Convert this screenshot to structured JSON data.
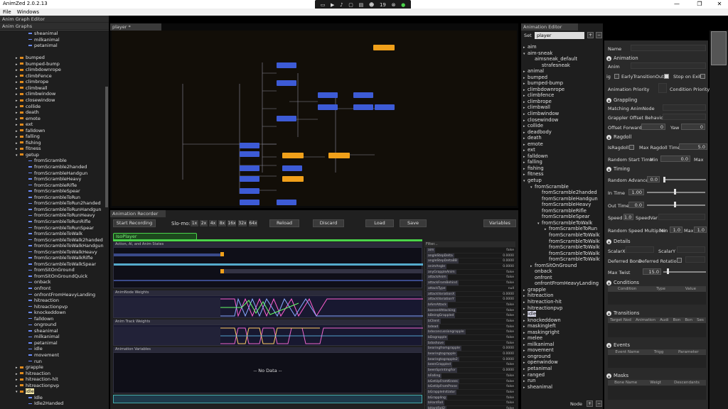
{
  "window": {
    "title": "AnimZed 2.0.2.13",
    "min": "—",
    "max": "❐",
    "close": "✕"
  },
  "tray": {
    "count": "19"
  },
  "menu": [
    "File",
    "Windows"
  ],
  "graph_tabs": [
    "Anim Graph Editor",
    "Anim Graphs"
  ],
  "tree": [
    {
      "label": "sheanimal",
      "type": "leaf",
      "indent": 3
    },
    {
      "label": "milkanimal",
      "type": "leaf",
      "indent": 3
    },
    {
      "label": "petanimal",
      "type": "leaf",
      "indent": 3
    },
    {
      "label": "",
      "type": "blank",
      "indent": 2
    },
    {
      "label": "bumped",
      "type": "folder",
      "indent": 2
    },
    {
      "label": "bumped-bump",
      "type": "folder",
      "indent": 2
    },
    {
      "label": "climbdownrope",
      "type": "folder",
      "indent": 2
    },
    {
      "label": "climbFence",
      "type": "folder",
      "indent": 2
    },
    {
      "label": "climbrope",
      "type": "folder",
      "indent": 2
    },
    {
      "label": "climbwall",
      "type": "folder",
      "indent": 2
    },
    {
      "label": "climbwindow",
      "type": "folder",
      "indent": 2
    },
    {
      "label": "closewindow",
      "type": "folder",
      "indent": 2
    },
    {
      "label": "collide",
      "type": "folder",
      "indent": 2
    },
    {
      "label": "death",
      "type": "folder",
      "indent": 2
    },
    {
      "label": "emote",
      "type": "folder",
      "indent": 2
    },
    {
      "label": "ext",
      "type": "folder",
      "indent": 2
    },
    {
      "label": "falldown",
      "type": "folder",
      "indent": 2
    },
    {
      "label": "falling",
      "type": "folder",
      "indent": 2
    },
    {
      "label": "fishing",
      "type": "folder",
      "indent": 2
    },
    {
      "label": "fitness",
      "type": "folder",
      "indent": 2
    },
    {
      "label": "getup",
      "type": "folder-open",
      "indent": 2
    },
    {
      "label": "fromScramble",
      "type": "leaf",
      "indent": 3
    },
    {
      "label": "fromScramble2handed",
      "type": "leaf",
      "indent": 3
    },
    {
      "label": "fromScrambleHandgun",
      "type": "leaf",
      "indent": 3
    },
    {
      "label": "fromScrambleHeavy",
      "type": "leaf",
      "indent": 3
    },
    {
      "label": "fromScrambleRifle",
      "type": "leaf",
      "indent": 3
    },
    {
      "label": "fromScrambleSpear",
      "type": "leaf",
      "indent": 3
    },
    {
      "label": "fromScrambleToRun",
      "type": "leaf",
      "indent": 3
    },
    {
      "label": "fromScrambleToRun2handed",
      "type": "leaf",
      "indent": 3
    },
    {
      "label": "fromScrambleToRunHandgun",
      "type": "leaf",
      "indent": 3
    },
    {
      "label": "fromScrambleToRunHeavy",
      "type": "leaf",
      "indent": 3
    },
    {
      "label": "fromScrambleToRunRifle",
      "type": "leaf",
      "indent": 3
    },
    {
      "label": "fromScrambleToRunSpear",
      "type": "leaf",
      "indent": 3
    },
    {
      "label": "fromScrambleToWalk",
      "type": "leaf",
      "indent": 3
    },
    {
      "label": "fromScrambleToWalk2handed",
      "type": "leaf",
      "indent": 3
    },
    {
      "label": "fromScrambleToWalkHandgun",
      "type": "leaf",
      "indent": 3
    },
    {
      "label": "fromScrambleToWalkHeavy",
      "type": "leaf",
      "indent": 3
    },
    {
      "label": "fromScrambleToWalkRifle",
      "type": "leaf",
      "indent": 3
    },
    {
      "label": "fromScrambleToWalkSpear",
      "type": "leaf",
      "indent": 3
    },
    {
      "label": "fromSitOnGround",
      "type": "leaf",
      "indent": 3
    },
    {
      "label": "fromSitOnGroundQuick",
      "type": "leaf",
      "indent": 3
    },
    {
      "label": "onback",
      "type": "leaf",
      "indent": 3
    },
    {
      "label": "onfront",
      "type": "leaf",
      "indent": 3
    },
    {
      "label": "onfrontFromHeavyLanding",
      "type": "leaf",
      "indent": 3
    },
    {
      "label": "hitreaction",
      "type": "leaf",
      "indent": 3
    },
    {
      "label": "hitreactionpvp",
      "type": "leaf",
      "indent": 3
    },
    {
      "label": "knockeddown",
      "type": "leaf",
      "indent": 3
    },
    {
      "label": "falldown",
      "type": "leaf",
      "indent": 3
    },
    {
      "label": "onground",
      "type": "leaf",
      "indent": 3
    },
    {
      "label": "sheanimal",
      "type": "leaf",
      "indent": 3
    },
    {
      "label": "milkanimal",
      "type": "leaf",
      "indent": 3
    },
    {
      "label": "petanimal",
      "type": "leaf",
      "indent": 3
    },
    {
      "label": "idle",
      "type": "leaf",
      "indent": 3
    },
    {
      "label": "movement",
      "type": "leaf",
      "indent": 3
    },
    {
      "label": "run",
      "type": "leaf",
      "indent": 3
    },
    {
      "label": "grapple",
      "type": "folder",
      "indent": 2
    },
    {
      "label": "hitreaction",
      "type": "folder",
      "indent": 2
    },
    {
      "label": "hitreaction-hit",
      "type": "folder",
      "indent": 2
    },
    {
      "label": "hitreactionpvp",
      "type": "folder",
      "indent": 2
    },
    {
      "label": "idle",
      "type": "folder-open-sel",
      "indent": 2
    },
    {
      "label": "Idle",
      "type": "leaf",
      "indent": 3
    },
    {
      "label": "Idle2Handed",
      "type": "leaf",
      "indent": 3
    }
  ],
  "player": {
    "tab": "player *"
  },
  "recorder": {
    "tab": "Animation Recorder",
    "start": "Start Recording",
    "slomo_label": "Slo-mo:",
    "speeds": [
      "1x",
      "2x",
      "4x",
      "8x",
      "16x",
      "32x",
      "64x"
    ],
    "reload": "Reload",
    "discard": "Discard",
    "load": "Load",
    "save": "Save",
    "variables": "Variables",
    "iso": "IsoPlayer",
    "sections": [
      "Action, AI, and Anim States",
      "AnimNode Weights",
      "Anim Track Weights",
      "Animation Variables"
    ],
    "nodata": "-- No Data --",
    "filter": "Filter...",
    "vars": [
      {
        "k": "aim",
        "v": "false"
      },
      {
        "k": "angleStepDelta",
        "v": "0.0000"
      },
      {
        "k": "angleStepDeltaBB",
        "v": "0.0000"
      },
      {
        "k": "animAngle",
        "v": "0.0000"
      },
      {
        "k": "anyGrappleAnim",
        "v": "false"
      },
      {
        "k": "attackAnim",
        "v": "false"
      },
      {
        "k": "attackFromBehind",
        "v": "false"
      },
      {
        "k": "attackType",
        "v": "null"
      },
      {
        "k": "attackVariationX",
        "v": "0.0000"
      },
      {
        "k": "attackVariationY",
        "v": "0.0000"
      },
      {
        "k": "bAimAttack",
        "v": "false"
      },
      {
        "k": "bannedAttacking",
        "v": "false"
      },
      {
        "k": "bBeingGrappled",
        "v": "false"
      },
      {
        "k": "bClient",
        "v": "false"
      },
      {
        "k": "bdead",
        "v": "false"
      },
      {
        "k": "bdoconcussiongrapple",
        "v": "false"
      },
      {
        "k": "bDograpple",
        "v": "false"
      },
      {
        "k": "bdoshove",
        "v": "false"
      },
      {
        "k": "bearingfromgrapple",
        "v": "0.0000"
      },
      {
        "k": "bearingtograpple",
        "v": "0.0000"
      },
      {
        "k": "bearingtograpple2",
        "v": "0.0000"
      },
      {
        "k": "beenGrappled",
        "v": "false"
      },
      {
        "k": "beenSprintingFor",
        "v": "0.0000"
      },
      {
        "k": "bFalling",
        "v": "false"
      },
      {
        "k": "bGetUpFromKnees",
        "v": "false"
      },
      {
        "k": "bGetUpFromProne",
        "v": "false"
      },
      {
        "k": "bGrappleInitiator",
        "v": "false"
      },
      {
        "k": "bGrappling",
        "v": "false"
      },
      {
        "k": "bHardFall",
        "v": "false"
      },
      {
        "k": "bHardFall2",
        "v": "false"
      },
      {
        "k": "bHighGrappling",
        "v": "false"
      },
      {
        "k": "bHolsterWeapon",
        "v": "false"
      }
    ]
  },
  "anim_editor": {
    "tab": "Animation Editor",
    "set_label": "Set",
    "set_value": "player",
    "node_label": "Node",
    "items": [
      {
        "label": "aim",
        "indent": 0,
        "arrow": "▸"
      },
      {
        "label": "aim-sneak",
        "indent": 0,
        "arrow": "▾"
      },
      {
        "label": "aimsneak_default",
        "indent": 1,
        "arrow": ""
      },
      {
        "label": "strafesneak",
        "indent": 2,
        "arrow": ""
      },
      {
        "label": "animal",
        "indent": 0,
        "arrow": "▸"
      },
      {
        "label": "bumped",
        "indent": 0,
        "arrow": "▸"
      },
      {
        "label": "bumped-bump",
        "indent": 0,
        "arrow": "▸"
      },
      {
        "label": "climbdownrope",
        "indent": 0,
        "arrow": "▸"
      },
      {
        "label": "climbfence",
        "indent": 0,
        "arrow": "▸"
      },
      {
        "label": "climbrope",
        "indent": 0,
        "arrow": "▸"
      },
      {
        "label": "climbwall",
        "indent": 0,
        "arrow": "▸"
      },
      {
        "label": "climbwindow",
        "indent": 0,
        "arrow": "▸"
      },
      {
        "label": "closewindow",
        "indent": 0,
        "arrow": "▸"
      },
      {
        "label": "collide",
        "indent": 0,
        "arrow": "▸"
      },
      {
        "label": "deadbody",
        "indent": 0,
        "arrow": "▸"
      },
      {
        "label": "death",
        "indent": 0,
        "arrow": "▸"
      },
      {
        "label": "emote",
        "indent": 0,
        "arrow": "▸"
      },
      {
        "label": "ext",
        "indent": 0,
        "arrow": "▸"
      },
      {
        "label": "falldown",
        "indent": 0,
        "arrow": "▸"
      },
      {
        "label": "falling",
        "indent": 0,
        "arrow": "▸"
      },
      {
        "label": "fishing",
        "indent": 0,
        "arrow": "▸"
      },
      {
        "label": "fitness",
        "indent": 0,
        "arrow": "▸"
      },
      {
        "label": "getup",
        "indent": 0,
        "arrow": "▾"
      },
      {
        "label": "fromScramble",
        "indent": 1,
        "arrow": "▾"
      },
      {
        "label": "fromScramble2handed",
        "indent": 2,
        "arrow": ""
      },
      {
        "label": "fromScrambleHandgun",
        "indent": 2,
        "arrow": ""
      },
      {
        "label": "fromScrambleHeavy",
        "indent": 2,
        "arrow": ""
      },
      {
        "label": "fromScrambleRifle",
        "indent": 2,
        "arrow": ""
      },
      {
        "label": "fromScrambleSpear",
        "indent": 2,
        "arrow": ""
      },
      {
        "label": "fromScrambleToWalk",
        "indent": 2,
        "arrow": "▾"
      },
      {
        "label": "fromScrambleToRun",
        "indent": 3,
        "arrow": "▸"
      },
      {
        "label": "fromScrambleToWalk2l",
        "indent": 3,
        "arrow": ""
      },
      {
        "label": "fromScrambleToWalkH",
        "indent": 3,
        "arrow": ""
      },
      {
        "label": "fromScrambleToWalkH",
        "indent": 3,
        "arrow": ""
      },
      {
        "label": "fromScrambleToWalkR",
        "indent": 3,
        "arrow": ""
      },
      {
        "label": "fromScrambleToWalkSj",
        "indent": 3,
        "arrow": ""
      },
      {
        "label": "fromSitOnGround",
        "indent": 1,
        "arrow": "▸"
      },
      {
        "label": "onback",
        "indent": 1,
        "arrow": ""
      },
      {
        "label": "onfront",
        "indent": 1,
        "arrow": ""
      },
      {
        "label": "onfrontFromHeavyLanding",
        "indent": 1,
        "arrow": ""
      },
      {
        "label": "grapple",
        "indent": 0,
        "arrow": "▸"
      },
      {
        "label": "hitreaction",
        "indent": 0,
        "arrow": "▸"
      },
      {
        "label": "hitreaction-hit",
        "indent": 0,
        "arrow": "▸"
      },
      {
        "label": "hitreactionpvp",
        "indent": 0,
        "arrow": "▸"
      },
      {
        "label": "idle",
        "indent": 0,
        "arrow": "▸",
        "sel": true
      },
      {
        "label": "knockeddown",
        "indent": 0,
        "arrow": "▸"
      },
      {
        "label": "maskingleft",
        "indent": 0,
        "arrow": "▸"
      },
      {
        "label": "maskingright",
        "indent": 0,
        "arrow": "▸"
      },
      {
        "label": "melee",
        "indent": 0,
        "arrow": "▸"
      },
      {
        "label": "milkanimal",
        "indent": 0,
        "arrow": "▸"
      },
      {
        "label": "movement",
        "indent": 0,
        "arrow": "▸"
      },
      {
        "label": "onground",
        "indent": 0,
        "arrow": "▸"
      },
      {
        "label": "openwindow",
        "indent": 0,
        "arrow": "▸"
      },
      {
        "label": "petanimal",
        "indent": 0,
        "arrow": "▸"
      },
      {
        "label": "ranged",
        "indent": 0,
        "arrow": "▸"
      },
      {
        "label": "run",
        "indent": 0,
        "arrow": "▸"
      },
      {
        "label": "sheanimal",
        "indent": 0,
        "arrow": "▸"
      }
    ]
  },
  "props": {
    "name": "Name",
    "animation": "Animation",
    "anim": "Anim",
    "ig": "ig",
    "early": "EarlyTransitionOut",
    "stop": "Stop on Exit",
    "priority": "Animation Priority",
    "cond_priority": "Condition Priority",
    "grappling": "Grappling",
    "matching": "Matching AnimNode",
    "grappler_offset": "Grappler Offset Behaviour",
    "offset_fwd": "Offset Forward",
    "offset_fwd_v": "0",
    "yaw": "Yaw",
    "yaw_v": "0",
    "ragdoll": "Ragdoll",
    "isragdoll": "IsRagdoll",
    "max_ragdoll": "Max Ragdoll Time",
    "max_ragdoll_v": "5.0",
    "rand_start": "Random Start Time",
    "min": "Min",
    "rand_start_v": "0.0",
    "max": "Max",
    "timing": "Timing",
    "rand_adv": "Random Advance",
    "rand_adv_v": "0.0",
    "in_time": "In Time",
    "in_time_v": "1.00",
    "out_time": "Out Time",
    "out_time_v": "0.0",
    "speed": "Speed",
    "speed_v": "1.0",
    "speedvar": "SpeedVar",
    "rand_speed": "Random Speed Multiplier",
    "min2": "Min",
    "min2_v": "1.0",
    "max2": "Max",
    "max2_v": "1.0",
    "details": "Details",
    "scalex": "ScalarX",
    "scaley": "ScalarY",
    "deferred_bone": "Deferred Bone",
    "deferred_rot": "Deferred Rotation",
    "max_twist": "Max Twist",
    "max_twist_v": "15.0",
    "conditions": "Conditions",
    "c_cols": [
      "Condition",
      "Type",
      "Value"
    ],
    "transitions": "Transitions",
    "t_cols": [
      "Target Nod",
      "Animation",
      "Audi",
      "Bon",
      "Bon",
      "Ses"
    ],
    "events": "Events",
    "e_cols": [
      "Event Name",
      "Trigg",
      "Parameter"
    ],
    "masks": "Masks",
    "m_cols": [
      "Bone Name",
      "Weigt",
      "Descendants"
    ]
  },
  "colors": {
    "accent_blue": "#3d5bd6",
    "accent_orange": "#f0a01a",
    "accent_green": "#4ad34a"
  }
}
